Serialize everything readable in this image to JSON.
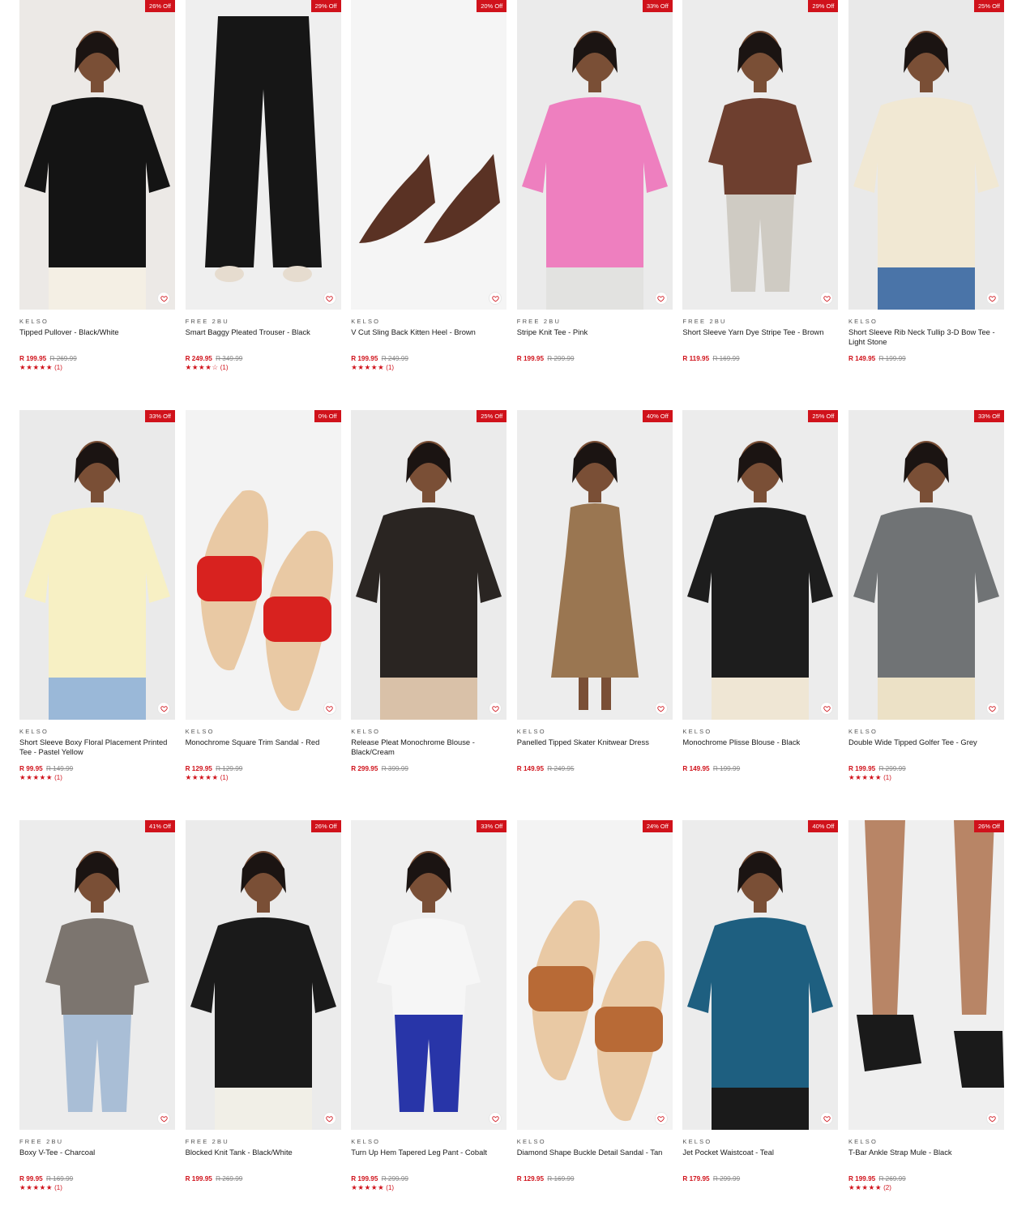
{
  "colors": {
    "accent": "#d0121b",
    "text": "#1a1a1a",
    "muted": "#888888"
  },
  "products": [
    {
      "discount": "26% Off",
      "brand": "KELSO",
      "name": "Tipped Pullover - Black/White",
      "price": "R 199.95",
      "was": "R 269.99",
      "stars": "★★★★★",
      "reviews": "(1)",
      "bg": "#ece9e6",
      "art": "top",
      "c1": "#141414",
      "c2": "#f4efe4"
    },
    {
      "discount": "29% Off",
      "brand": "FREE 2BU",
      "name": "Smart Baggy Pleated Trouser - Black",
      "price": "R 249.95",
      "was": "R 349.99",
      "stars": "★★★★☆",
      "reviews": "(1)",
      "bg": "#efefef",
      "art": "pants",
      "c1": "#161616",
      "c2": "#efefef"
    },
    {
      "discount": "20% Off",
      "brand": "KELSO",
      "name": "V Cut Sling Back Kitten Heel - Brown",
      "price": "R 199.95",
      "was": "R 249.99",
      "stars": "★★★★★",
      "reviews": "(1)",
      "bg": "#f5f5f5",
      "art": "heels",
      "c1": "#5a3224",
      "c2": "#f5f5f5"
    },
    {
      "discount": "33% Off",
      "brand": "FREE 2BU",
      "name": "Stripe Knit Tee - Pink",
      "price": "R 199.95",
      "was": "R 299.99",
      "stars": "",
      "reviews": "",
      "bg": "#ebebeb",
      "art": "top",
      "c1": "#ee7fbf",
      "c2": "#e2e2e0"
    },
    {
      "discount": "29% Off",
      "brand": "FREE 2BU",
      "name": "Short Sleeve Yarn Dye Stripe Tee - Brown",
      "price": "R 119.95",
      "was": "R 169.99",
      "stars": "",
      "reviews": "",
      "bg": "#ececec",
      "art": "person",
      "c1": "#6e3f2f",
      "c2": "#cfcbc3"
    },
    {
      "discount": "25% Off",
      "brand": "KELSO",
      "name": "Short Sleeve Rib Neck Tullip 3-D Bow Tee - Light Stone",
      "price": "R 149.95",
      "was": "R 199.99",
      "stars": "",
      "reviews": "",
      "bg": "#e9e9e9",
      "art": "top",
      "c1": "#f1e8d3",
      "c2": "#4a74a8"
    },
    {
      "discount": "33% Off",
      "brand": "KELSO",
      "name": "Short Sleeve Boxy Floral Placement Printed Tee - Pastel Yellow",
      "price": "R 99.95",
      "was": "R 149.99",
      "stars": "★★★★★",
      "reviews": "(1)",
      "bg": "#eaeaea",
      "art": "top",
      "c1": "#f7f0c4",
      "c2": "#9ab8d8"
    },
    {
      "discount": "0% Off",
      "brand": "KELSO",
      "name": "Monochrome Square Trim Sandal - Red",
      "price": "R 129.95",
      "was": "R 129.99",
      "stars": "★★★★★",
      "reviews": "(1)",
      "bg": "#f3f3f3",
      "art": "sandals",
      "c1": "#d8221f",
      "c2": "#f3f3f3"
    },
    {
      "discount": "25% Off",
      "brand": "KELSO",
      "name": "Release Pleat Monochrome Blouse - Black/Cream",
      "price": "R 299.95",
      "was": "R 399.99",
      "stars": "",
      "reviews": "",
      "bg": "#ebebeb",
      "art": "top",
      "c1": "#2a2522",
      "c2": "#d9c1a8"
    },
    {
      "discount": "40% Off",
      "brand": "KELSO",
      "name": "Panelled Tipped Skater Knitwear Dress",
      "price": "R 149.95",
      "was": "R 249.95",
      "stars": "",
      "reviews": "",
      "bg": "#ededed",
      "art": "dress",
      "c1": "#9a7651",
      "c2": "#ededed"
    },
    {
      "discount": "25% Off",
      "brand": "KELSO",
      "name": "Monochrome Plisse Blouse - Black",
      "price": "R 149.95",
      "was": "R 199.99",
      "stars": "",
      "reviews": "",
      "bg": "#ececec",
      "art": "top",
      "c1": "#1d1d1d",
      "c2": "#efe6d4"
    },
    {
      "discount": "33% Off",
      "brand": "KELSO",
      "name": "Double Wide Tipped Golfer Tee - Grey",
      "price": "R 199.95",
      "was": "R 299.99",
      "stars": "★★★★★",
      "reviews": "(1)",
      "bg": "#ebebeb",
      "art": "top",
      "c1": "#707375",
      "c2": "#ece1c6"
    },
    {
      "discount": "41% Off",
      "brand": "FREE 2BU",
      "name": "Boxy V-Tee - Charcoal",
      "price": "R 99.95",
      "was": "R 169.99",
      "stars": "★★★★★",
      "reviews": "(1)",
      "bg": "#ececec",
      "art": "person",
      "c1": "#7c756f",
      "c2": "#a9bed6"
    },
    {
      "discount": "26% Off",
      "brand": "FREE 2BU",
      "name": "Blocked Knit Tank - Black/White",
      "price": "R 199.95",
      "was": "R 269.99",
      "stars": "",
      "reviews": "",
      "bg": "#ebebeb",
      "art": "top",
      "c1": "#1a1a1a",
      "c2": "#f1efe7"
    },
    {
      "discount": "33% Off",
      "brand": "KELSO",
      "name": "Turn Up Hem Tapered Leg Pant - Cobalt",
      "price": "R 199.95",
      "was": "R 299.99",
      "stars": "★★★★★",
      "reviews": "(1)",
      "bg": "#efefef",
      "art": "person",
      "c1": "#f6f6f6",
      "c2": "#2835a8"
    },
    {
      "discount": "24% Off",
      "brand": "KELSO",
      "name": "Diamond Shape Buckle Detail Sandal - Tan",
      "price": "R 129.95",
      "was": "R 169.99",
      "stars": "",
      "reviews": "",
      "bg": "#f3f3f3",
      "art": "sandals",
      "c1": "#b86a36",
      "c2": "#f3f3f3"
    },
    {
      "discount": "40% Off",
      "brand": "KELSO",
      "name": "Jet Pocket Waistcoat - Teal",
      "price": "R 179.95",
      "was": "R 299.99",
      "stars": "",
      "reviews": "",
      "bg": "#ececec",
      "art": "top",
      "c1": "#1e5f80",
      "c2": "#1a1a1a"
    },
    {
      "discount": "26% Off",
      "brand": "KELSO",
      "name": "T-Bar Ankle Strap Mule - Black",
      "price": "R 199.95",
      "was": "R 269.99",
      "stars": "★★★★★",
      "reviews": "(2)",
      "bg": "#efefef",
      "art": "legs",
      "c1": "#1a1a1a",
      "c2": "#b88566"
    }
  ]
}
